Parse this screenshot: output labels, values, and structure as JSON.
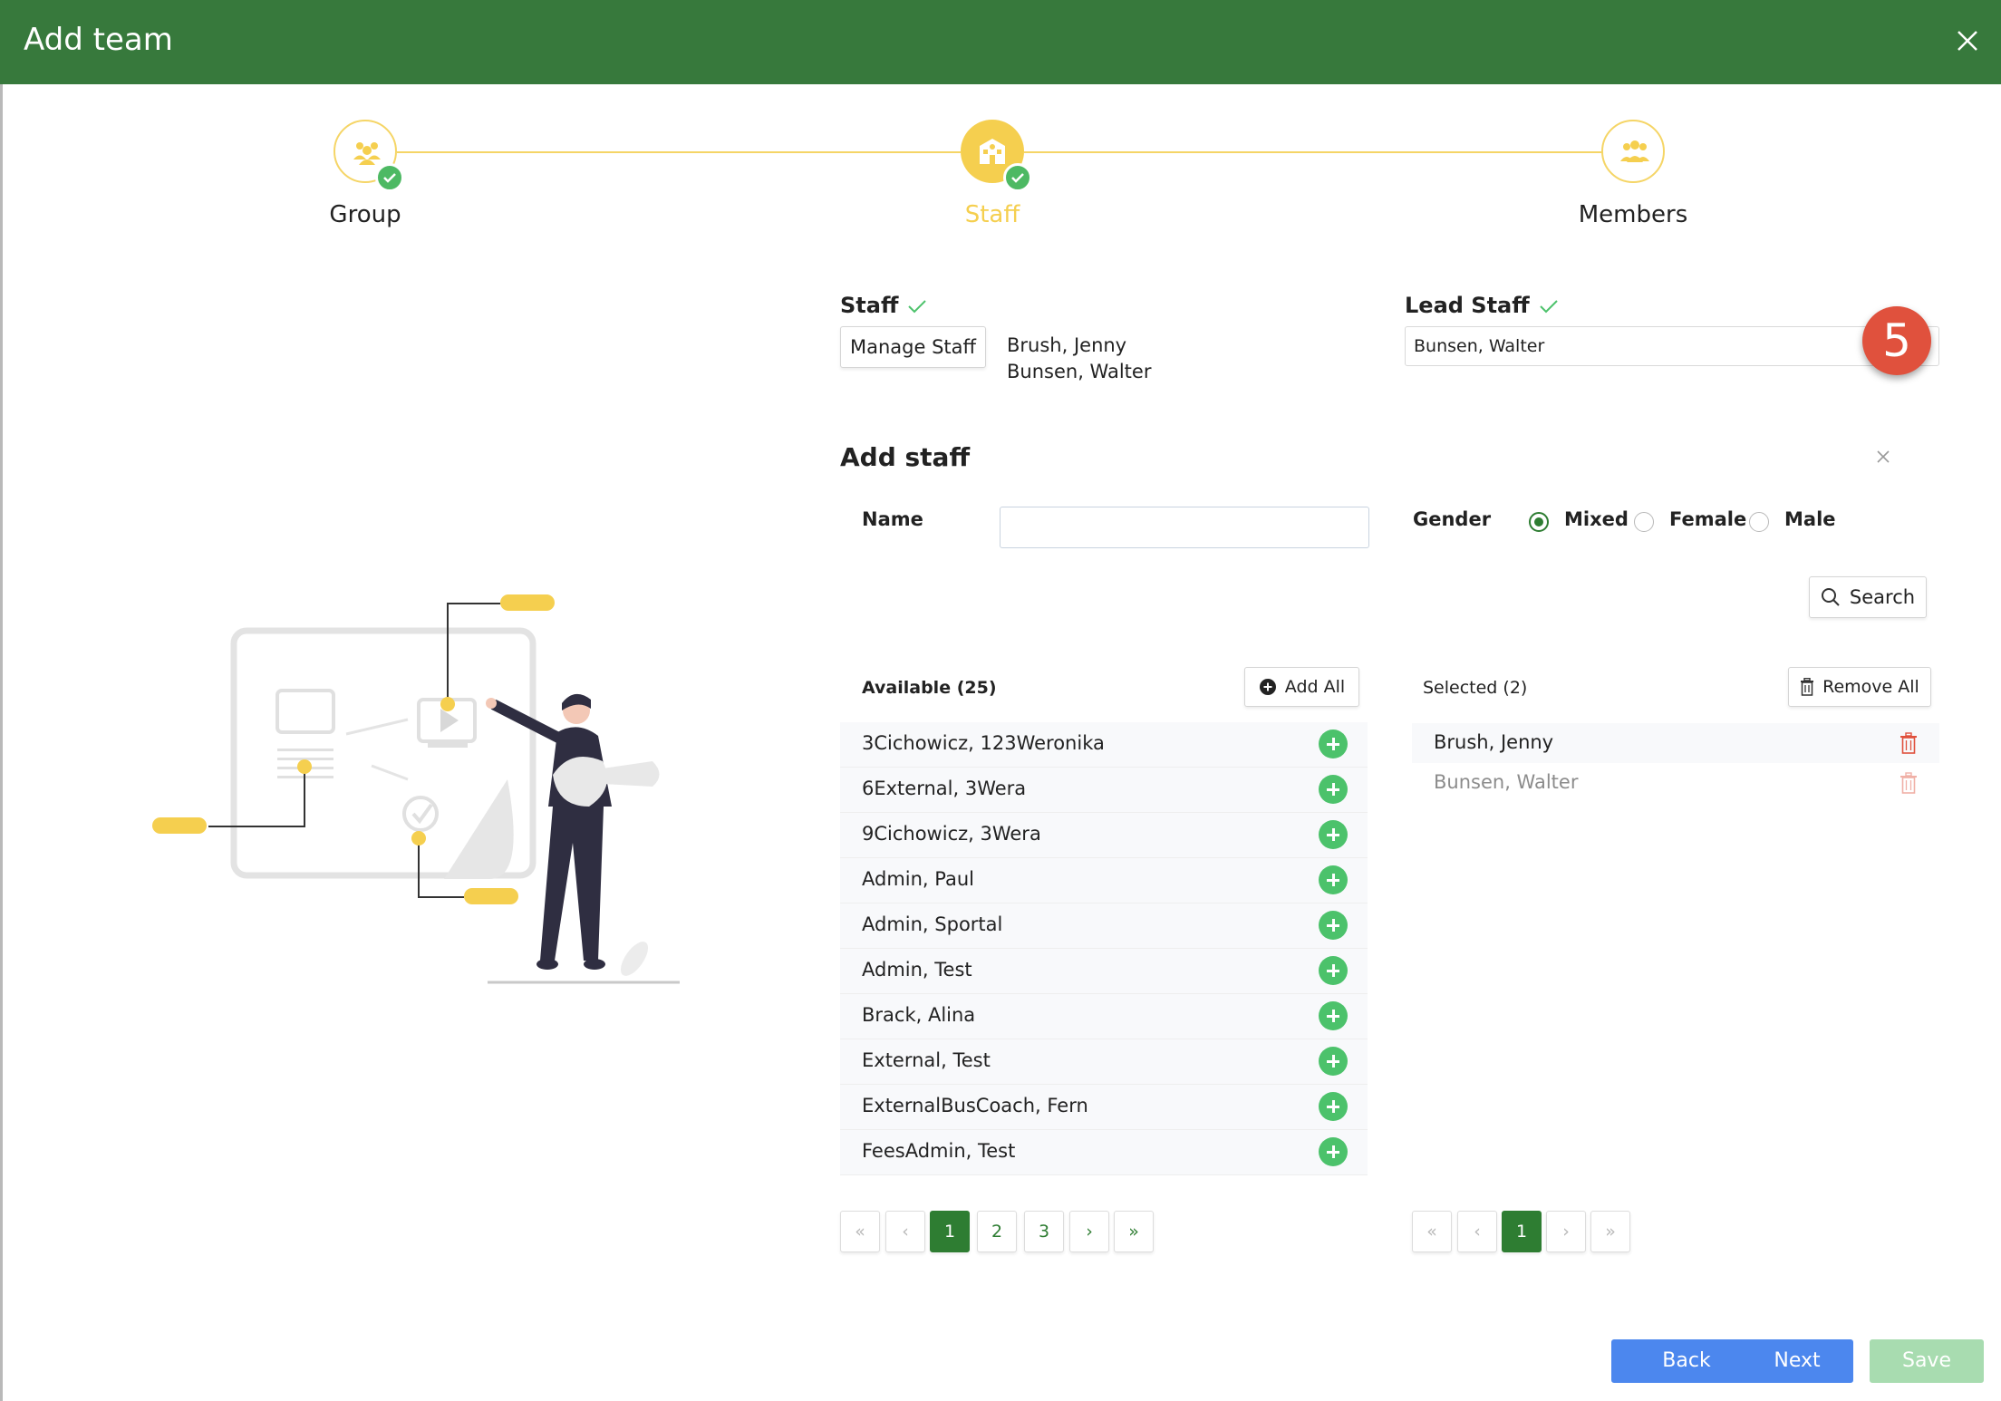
{
  "dialog": {
    "title": "Add team"
  },
  "stepper": {
    "steps": [
      {
        "label": "Group",
        "icon": "group-icon",
        "state": "done"
      },
      {
        "label": "Staff",
        "icon": "building-icon",
        "state": "active"
      },
      {
        "label": "Members",
        "icon": "members-icon",
        "state": "pending"
      }
    ]
  },
  "staff": {
    "label": "Staff",
    "manage_button": "Manage Staff",
    "assigned": [
      "Brush, Jenny",
      "Bunsen, Walter"
    ]
  },
  "lead_staff": {
    "label": "Lead Staff",
    "value": "Bunsen, Walter"
  },
  "callout": {
    "number": "5"
  },
  "add_staff": {
    "title": "Add staff",
    "name_label": "Name",
    "name_value": "",
    "gender_label": "Gender",
    "gender_options": [
      "Mixed",
      "Female",
      "Male"
    ],
    "gender_selected": "Mixed",
    "search_button": "Search"
  },
  "available": {
    "header": "Available (25)",
    "add_all_button": "Add All",
    "items": [
      "3Cichowicz, 123Weronika",
      "6External, 3Wera",
      "9Cichowicz, 3Wera",
      "Admin, Paul",
      "Admin, Sportal",
      "Admin, Test",
      "Brack, Alina",
      "External, Test",
      "ExternalBusCoach, Fern",
      "FeesAdmin, Test"
    ],
    "pagination": {
      "first": "«",
      "prev": "‹",
      "pages": [
        "1",
        "2",
        "3"
      ],
      "current": "1",
      "next": "›",
      "last": "»"
    }
  },
  "selected": {
    "header": "Selected (2)",
    "remove_all_button": "Remove All",
    "items": [
      {
        "label": "Brush, Jenny",
        "muted": false
      },
      {
        "label": "Bunsen, Walter",
        "muted": true
      }
    ],
    "pagination": {
      "first": "«",
      "prev": "‹",
      "pages": [
        "1"
      ],
      "current": "1",
      "next": "›",
      "last": "»"
    }
  },
  "footer": {
    "back": "Back",
    "next": "Next",
    "save": "Save"
  },
  "colors": {
    "header_green": "#37793c",
    "accent_yellow": "#f5cf4f",
    "add_green": "#4cc26b",
    "button_blue": "#4c87ee",
    "save_disabled": "#a8dcb0",
    "delete_red": "#e0513d"
  }
}
